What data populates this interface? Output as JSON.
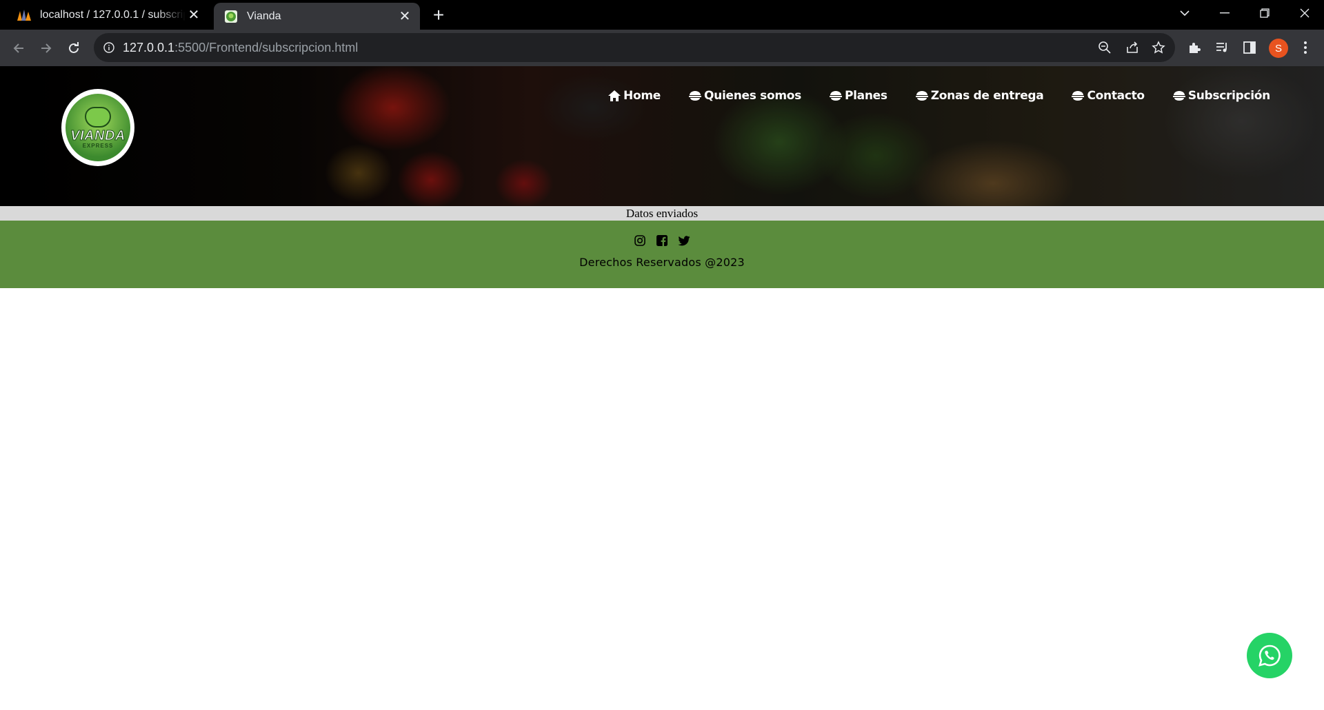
{
  "browser": {
    "tabs": [
      {
        "title": "localhost / 127.0.0.1 / subscripcion",
        "active": false,
        "favicon": "phpmyadmin-icon"
      },
      {
        "title": "Vianda",
        "active": true,
        "favicon": "vianda-favicon"
      }
    ],
    "new_tab": "+",
    "url_host": "127.0.0.1",
    "url_rest": ":5500/Frontend/subscripcion.html",
    "profile_initial": "S",
    "profile_color": "#e8531f"
  },
  "site": {
    "logo": {
      "text": "VIANDA",
      "subtext": "EXPRESS"
    },
    "nav": [
      {
        "label": "Home",
        "icon": "home-icon"
      },
      {
        "label": "Quienes somos",
        "icon": "bowl-icon"
      },
      {
        "label": "Planes",
        "icon": "bowl-icon"
      },
      {
        "label": "Zonas de entrega",
        "icon": "bowl-icon"
      },
      {
        "label": "Contacto",
        "icon": "bowl-icon"
      },
      {
        "label": "Subscripción",
        "icon": "bowl-icon"
      }
    ],
    "status_message": "Datos enviados",
    "footer": {
      "social": [
        "instagram-icon",
        "facebook-icon",
        "twitter-icon"
      ],
      "copyright": "Derechos Reservados @2023",
      "color": "#5b8c3d"
    },
    "whatsapp_color": "#25d366"
  }
}
